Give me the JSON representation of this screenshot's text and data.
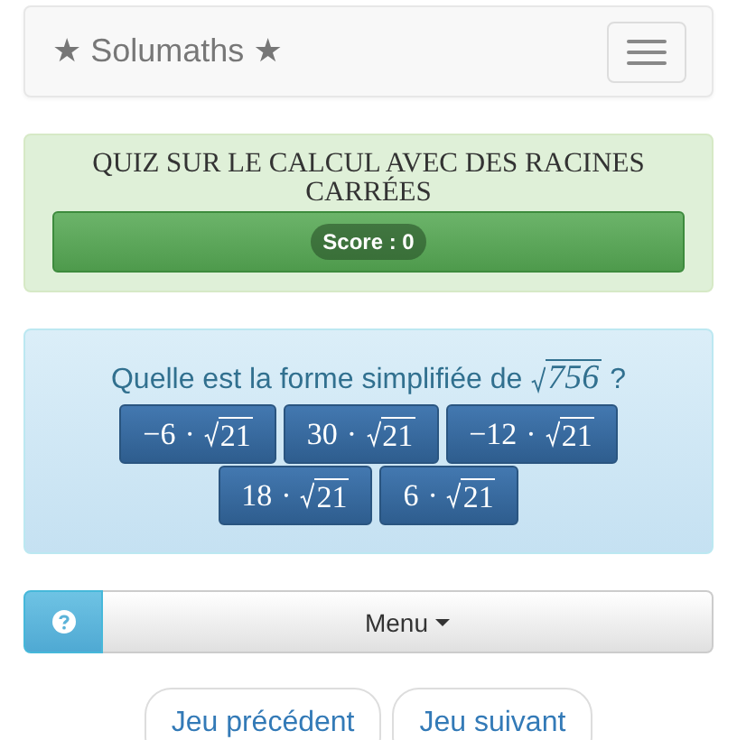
{
  "navbar": {
    "brand_star_left": "★",
    "brand": "Solumaths",
    "brand_star_right": "★"
  },
  "quiz": {
    "title": "QUIZ SUR LE CALCUL AVEC DES RACINES CARRÉES",
    "score": "Score : 0"
  },
  "question": {
    "text": "Quelle est la forme simplifiée de",
    "radicand": "756",
    "end": "?"
  },
  "answers": [
    {
      "coefficient": "−6",
      "operator": "·",
      "radicand": "21"
    },
    {
      "coefficient": "30",
      "operator": "·",
      "radicand": "21"
    },
    {
      "coefficient": "−12",
      "operator": "·",
      "radicand": "21"
    },
    {
      "coefficient": "18",
      "operator": "·",
      "radicand": "21"
    },
    {
      "coefficient": "6",
      "operator": "·",
      "radicand": "21"
    }
  ],
  "menu": {
    "label": "Menu"
  },
  "nav_buttons": [
    "Jeu précédent",
    "Jeu suivant"
  ]
}
